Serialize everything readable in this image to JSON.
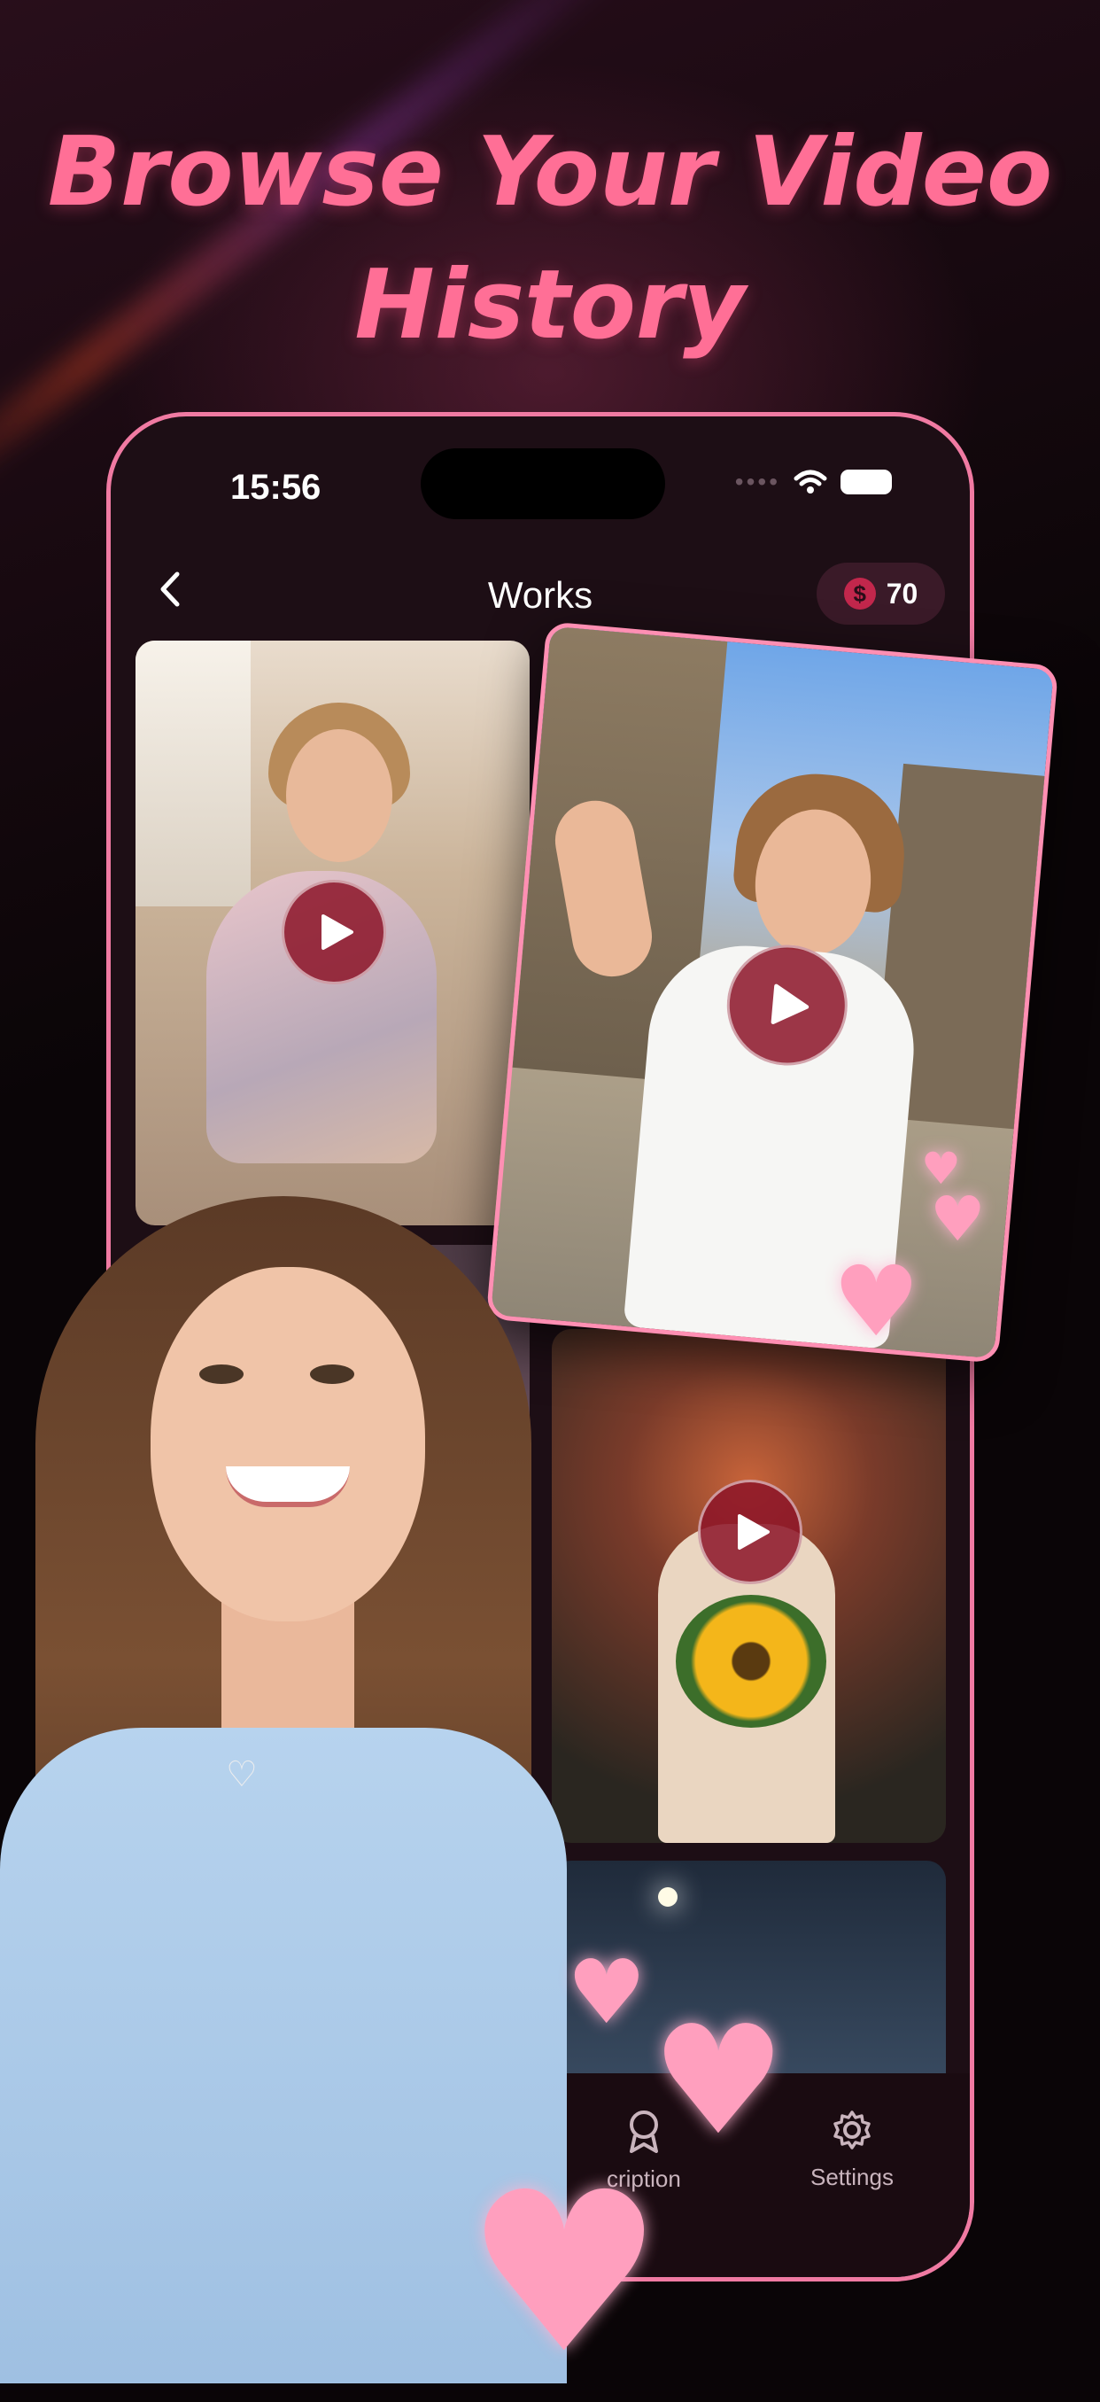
{
  "headline": {
    "line1": "Browse Your Video",
    "line2": "History"
  },
  "status_bar": {
    "time": "15:56",
    "signal_icon": "cellular-dots-icon",
    "wifi_icon": "wifi-icon",
    "battery_icon": "battery-icon"
  },
  "nav": {
    "back_icon": "chevron-left-icon",
    "title": "Works",
    "coin_symbol": "$",
    "coin_balance": "70"
  },
  "videos": [
    {
      "name": "sweater-video",
      "play_icon": "play-icon"
    },
    {
      "name": "peace-sign-video",
      "play_icon": "play-icon"
    },
    {
      "name": "sunflower-video",
      "play_icon": "play-icon"
    },
    {
      "name": "night-video"
    },
    {
      "name": "purple-flowers-video"
    }
  ],
  "tabbar": {
    "subscription_label": "cription",
    "settings_label": "Settings",
    "subscription_icon": "award-icon",
    "settings_icon": "gear-icon"
  },
  "colors": {
    "accent_pink": "#ff6f96",
    "phone_border": "#f07aa2",
    "play_button": "#8c1428",
    "background": "#0a0507"
  }
}
